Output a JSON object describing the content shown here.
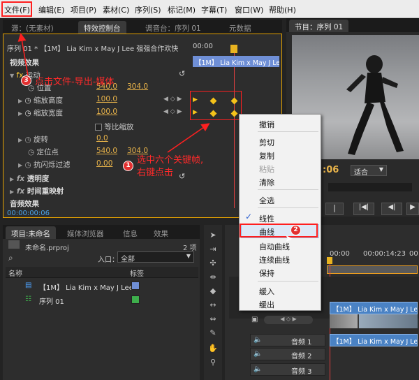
{
  "menubar": {
    "items": [
      "文件(F)",
      "编辑(E)",
      "项目(P)",
      "素材(C)",
      "序列(S)",
      "标记(M)",
      "字幕(T)",
      "窗口(W)",
      "帮助(H)"
    ]
  },
  "effect_controls": {
    "tabs": [
      "源：(无素材)",
      "特效控制台",
      "调音台：序列 01",
      "元数据"
    ],
    "sequence_label": "序列 01 * 【1M】 Lia Kim x May J Lee 强强合作欢快",
    "timecode_start": "00:00",
    "clip_label": "【1M】 Lia Kim x May J Lee",
    "section_video": "视频效果",
    "motion": "运动",
    "position": {
      "label": "位置",
      "x": "540.0",
      "y": "304.0"
    },
    "scale_height": {
      "label": "缩放高度",
      "value": "100.0"
    },
    "scale_width": {
      "label": "缩放宽度",
      "value": "100.0"
    },
    "uniform_scale": "等比缩放",
    "rotation": {
      "label": "旋转",
      "value": "0.0"
    },
    "anchor": {
      "label": "定位点",
      "x": "540.0",
      "y": "304.0"
    },
    "flicker": {
      "label": "抗闪烁过滤",
      "value": "0.00"
    },
    "opacity": "透明度",
    "time_remap": "时间重映射",
    "section_audio": "音频效果",
    "current_time": "00:00:00:06"
  },
  "program_monitor": {
    "title": "节目：序列 01",
    "timecode": ":06",
    "fit": "适合"
  },
  "context_menu": {
    "items": [
      "撤销",
      "剪切",
      "复制",
      "粘贴",
      "清除",
      "全选",
      "线性",
      "曲线",
      "自动曲线",
      "连续曲线",
      "保持",
      "缓入",
      "缓出"
    ],
    "disabled": [
      "粘贴"
    ],
    "checked": "线性",
    "highlighted": "曲线"
  },
  "annotations": {
    "note1": "选中六个关键帧,",
    "note2": "右键点击",
    "note3": "点击文件-导出-媒体",
    "badge1": "1",
    "badge2": "2",
    "badge3": "3"
  },
  "project_panel": {
    "tabs": [
      "项目:未命名",
      "媒体浏览器",
      "信息",
      "效果"
    ],
    "item_count": "2 项",
    "filename": "未命名.prproj",
    "entry_label": "入口：",
    "entry_value": "全部",
    "col_name": "名称",
    "col_label": "标签",
    "items": [
      {
        "name": "【1M】 Lia Kim x May J Lee",
        "color": "#6f8fd6"
      },
      {
        "name": "序列 01",
        "color": "#3eae4c"
      }
    ]
  },
  "timeline": {
    "timecode_a": "00:00",
    "timecode_b": "00:00:14:23",
    "timecode_c": "00",
    "clip_video": "【1M】 Lia Kim x May J Le",
    "clip_audio": "【1M】 Lia Kim x May J Le",
    "audio_tracks": [
      "音频 1",
      "音频 2",
      "音频 3"
    ]
  }
}
